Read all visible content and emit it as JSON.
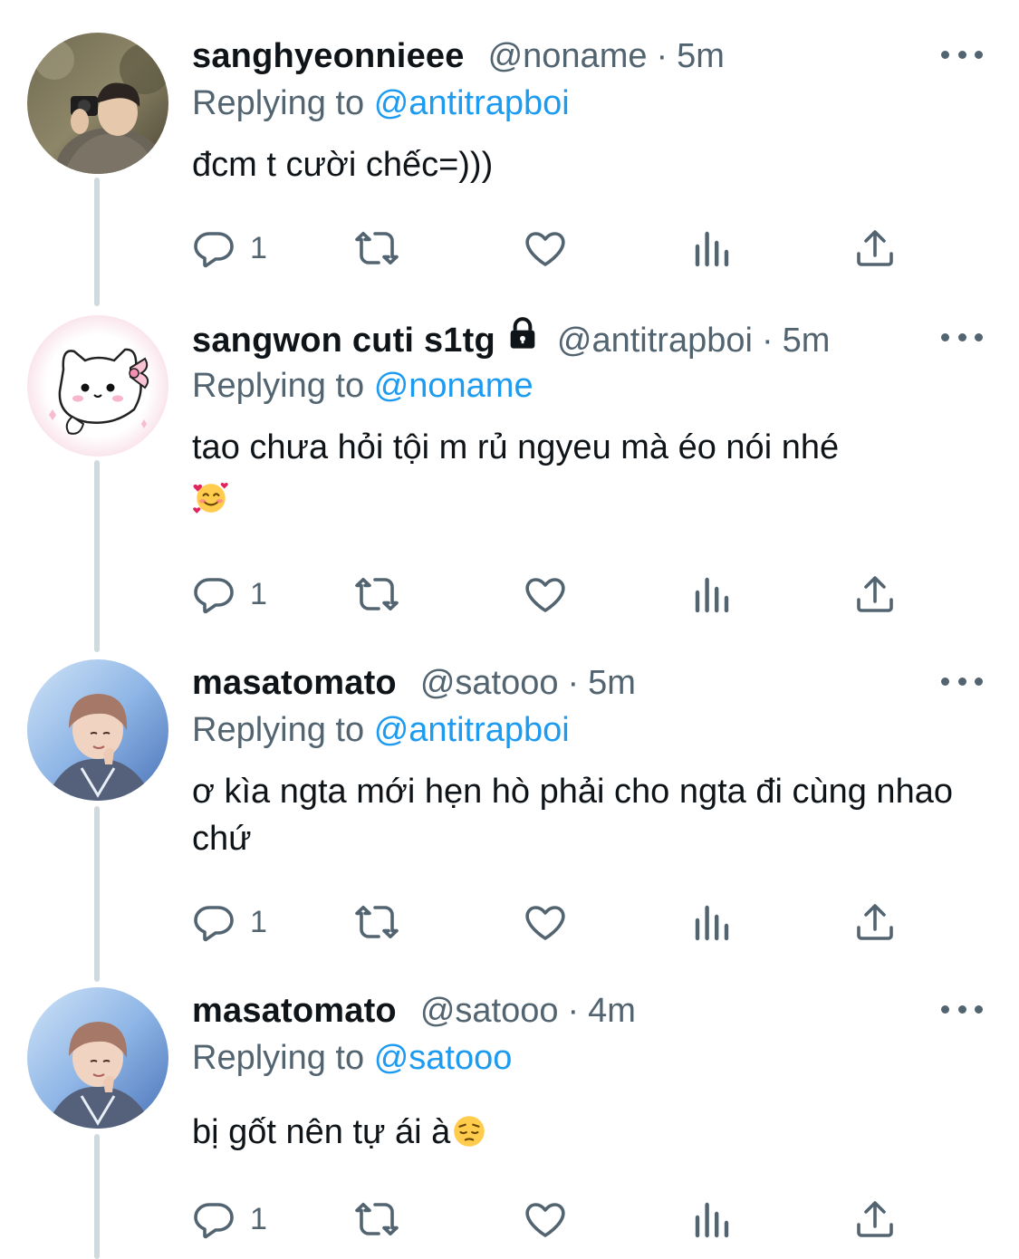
{
  "colors": {
    "link": "#1d9bf0",
    "secondary_text": "#536471",
    "primary_text": "#0f1419",
    "thread_line": "#cfd9de"
  },
  "tweets": [
    {
      "display_name": "sanghyeonnieee",
      "handle": "@noname",
      "dot": "·",
      "time": "5m",
      "replying_prefix": "Replying to",
      "replying_to": "@antitrapboi",
      "text": "đcm t cười chếc=)))",
      "reply_count": "1",
      "avatar_icon": "photo-avatar-icon"
    },
    {
      "display_name": "sangwon cuti s1tg",
      "locked": true,
      "handle": "@antitrapboi",
      "dot": "·",
      "time": "5m",
      "replying_prefix": "Replying to",
      "replying_to": "@noname",
      "text": "tao chưa hỏi tội m rủ ngyeu mà éo nói nhé",
      "emoji": "smiling-face-with-hearts-emoji",
      "reply_count": "1",
      "avatar_icon": "cartoon-cat-avatar-icon"
    },
    {
      "display_name": "masatomato",
      "handle": "@satooo",
      "dot": "·",
      "time": "5m",
      "replying_prefix": "Replying to",
      "replying_to": "@antitrapboi",
      "text": "ơ kìa ngta mới hẹn hò phải cho ngta đi cùng nhao chứ",
      "reply_count": "1",
      "avatar_icon": "photo-avatar-icon"
    },
    {
      "display_name": "masatomato",
      "handle": "@satooo",
      "dot": "·",
      "time": "4m",
      "replying_prefix": "Replying to",
      "replying_to": "@satooo",
      "text": "bị gốt nên tự ái à",
      "emoji": "pensive-face-emoji",
      "reply_count": "1",
      "avatar_icon": "photo-avatar-icon"
    }
  ]
}
